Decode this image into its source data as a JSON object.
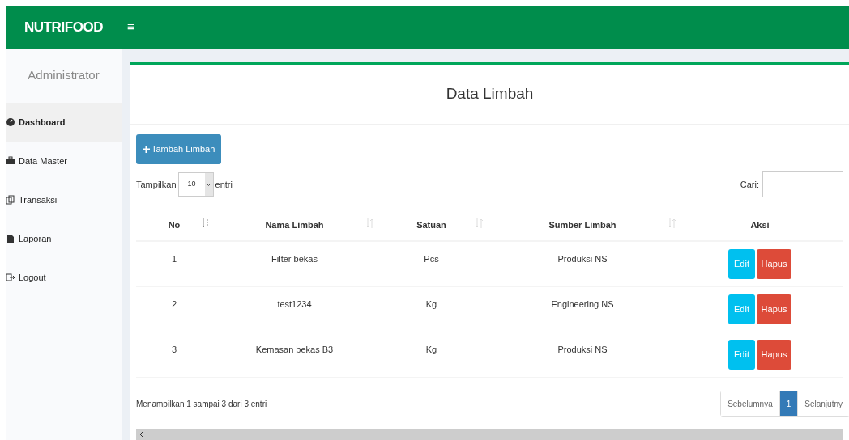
{
  "header": {
    "brand": "NUTRIFOOD",
    "menu_toggle": "≡"
  },
  "sidebar": {
    "user": "Administrator",
    "items": [
      {
        "label": "Dashboard",
        "selected": true
      },
      {
        "label": "Data Master",
        "selected": false
      },
      {
        "label": "Transaksi",
        "selected": false
      },
      {
        "label": "Laporan",
        "selected": false
      },
      {
        "label": "Logout",
        "selected": false
      }
    ]
  },
  "panel": {
    "title": "Data Limbah",
    "add_button": "Tambah Limbah",
    "show_label": "Tampilkan",
    "page_size": "10",
    "entries_label": "entri",
    "search_label": "Cari:",
    "table": {
      "columns": [
        {
          "label": "No"
        },
        {
          "label": "Nama Limbah"
        },
        {
          "label": "Satuan"
        },
        {
          "label": "Sumber Limbah"
        },
        {
          "label": "Aksi"
        }
      ],
      "rows": [
        {
          "no": "1",
          "name": "Filter bekas",
          "unit": "Pcs",
          "source": "Produksi NS",
          "edit": "Edit",
          "delete": "Hapus"
        },
        {
          "no": "2",
          "name": "test1234",
          "unit": "Kg",
          "source": "Engineering NS",
          "edit": "Edit",
          "delete": "Hapus"
        },
        {
          "no": "3",
          "name": "Kemasan bekas B3",
          "unit": "Kg",
          "source": "Produksi NS",
          "edit": "Edit",
          "delete": "Hapus"
        }
      ]
    },
    "info": "Menampilkan 1 sampai 3 dari 3 entri",
    "pagination": [
      {
        "label": "Sebelumnya",
        "selected": false
      },
      {
        "label": "1",
        "selected": true
      },
      {
        "label": "Selanjutny",
        "selected": false
      }
    ]
  }
}
